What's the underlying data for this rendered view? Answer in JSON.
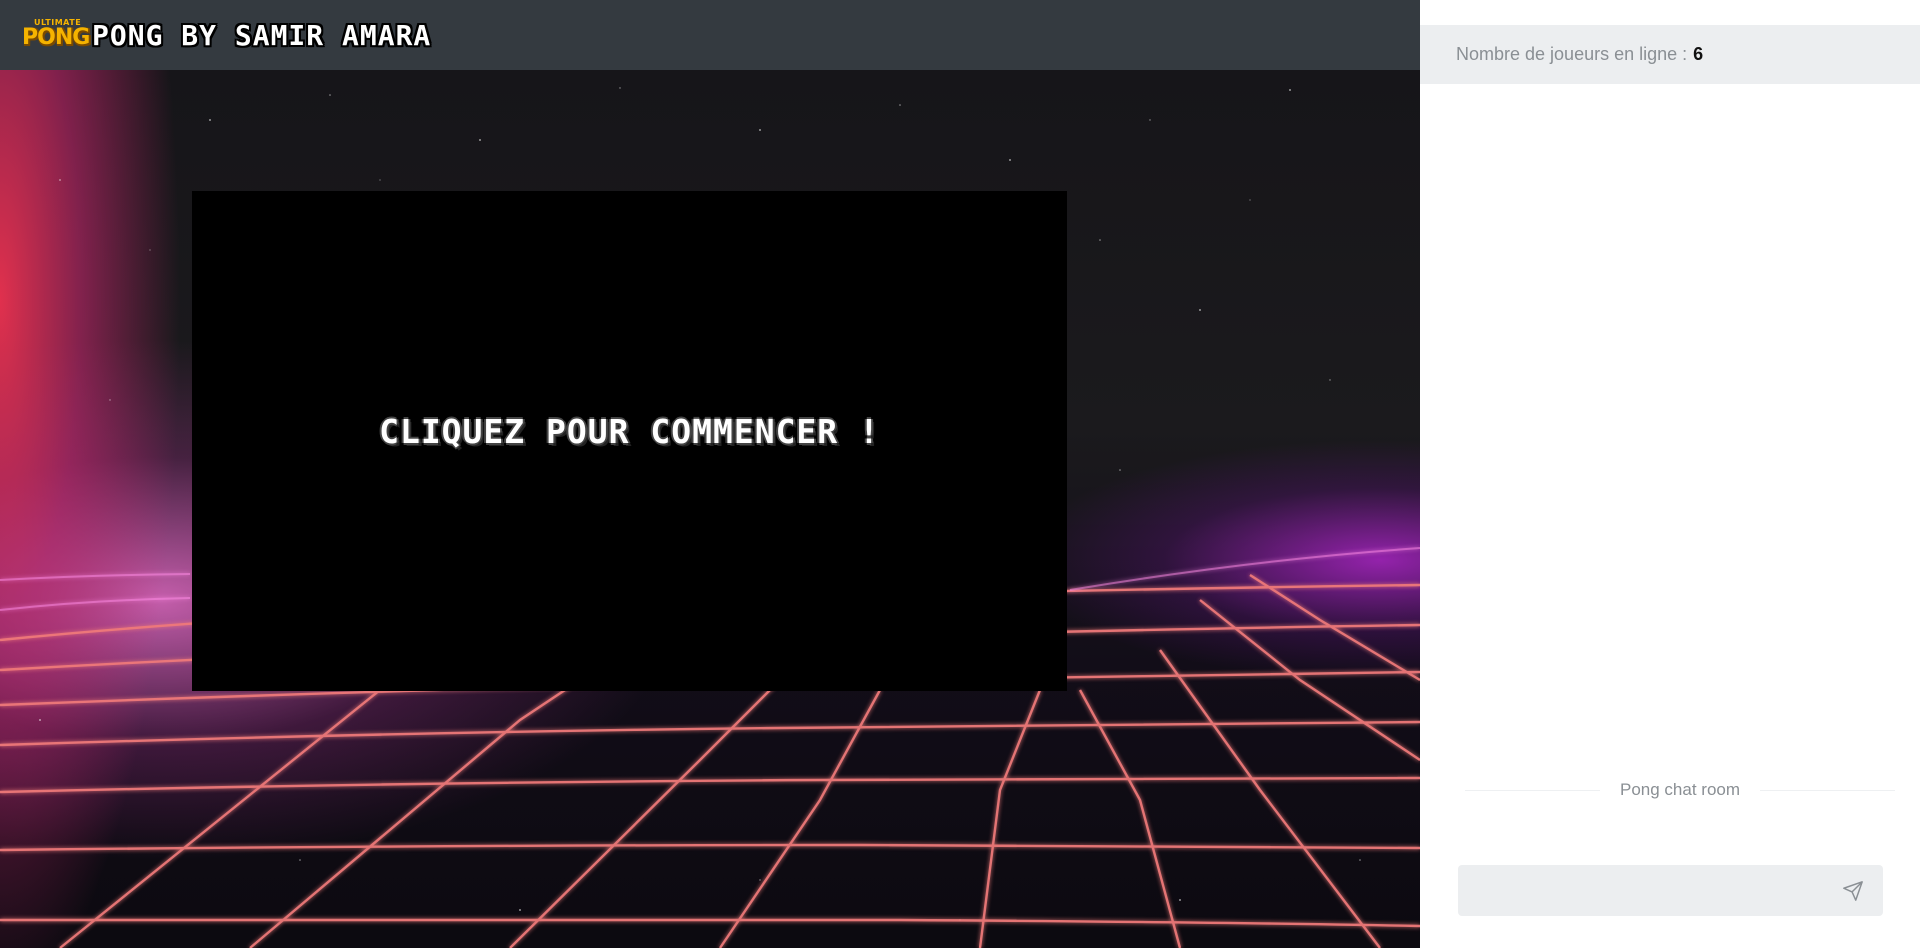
{
  "header": {
    "logo_top": "ULTIMATE",
    "logo_main": "PONG",
    "title": "PONG BY SAMIR AMARA"
  },
  "game": {
    "start_prompt": "CLIQUEZ POUR COMMENCER !"
  },
  "chat": {
    "online_label": "Nombre de joueurs en ligne :",
    "online_count": "6",
    "room_label": "Pong chat room",
    "message_placeholder": "",
    "send_icon": "send-icon"
  },
  "colors": {
    "header_bg": "#343a40",
    "logo_accent": "#f5b300",
    "panel_bg": "#ffffff",
    "online_bar_bg": "#eceef0",
    "grid_line": "#f07a7a",
    "grid_glow": "#ff6fe0"
  }
}
